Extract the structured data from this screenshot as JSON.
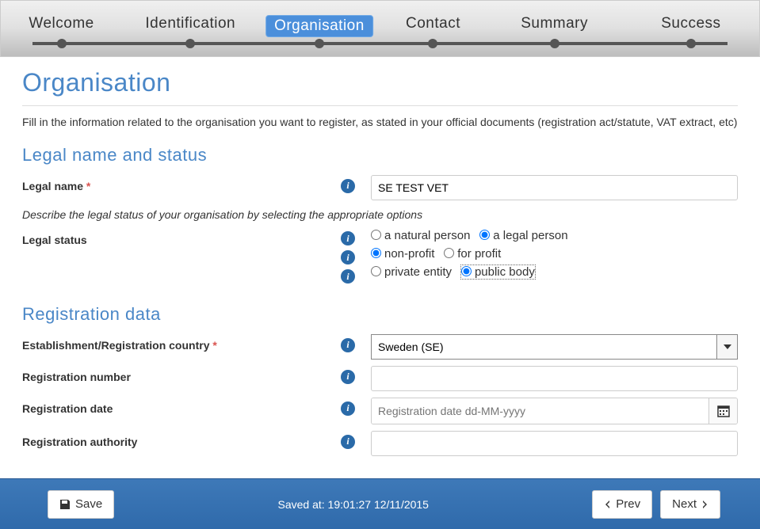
{
  "stepper": {
    "steps": [
      {
        "label": "Welcome",
        "pos": 8
      },
      {
        "label": "Identification",
        "pos": 25
      },
      {
        "label": "Organisation",
        "pos": 42,
        "active": true
      },
      {
        "label": "Contact",
        "pos": 57
      },
      {
        "label": "Summary",
        "pos": 73
      },
      {
        "label": "Success",
        "pos": 91
      }
    ]
  },
  "page": {
    "title": "Organisation",
    "intro": "Fill in the information related to the organisation you want to register, as stated in your official documents (registration act/statute, VAT extract, etc)"
  },
  "section1": {
    "title": "Legal name and status",
    "legal_name_label": "Legal name",
    "legal_name_value": "SE TEST VET",
    "describe": "Describe the legal status of your organisation by selecting the appropriate options",
    "legal_status_label": "Legal status",
    "radios": {
      "r1a": "a natural person",
      "r1b": "a legal person",
      "r2a": "non-profit",
      "r2b": "for profit",
      "r3a": "private entity",
      "r3b": "public body"
    }
  },
  "section2": {
    "title": "Registration data",
    "country_label": "Establishment/Registration country",
    "country_value": "Sweden (SE)",
    "number_label": "Registration number",
    "number_value": "",
    "date_label": "Registration date",
    "date_placeholder": "Registration date dd-MM-yyyy",
    "authority_label": "Registration authority",
    "authority_value": ""
  },
  "footer": {
    "save": "Save",
    "saved_at": "Saved at: 19:01:27 12/11/2015",
    "prev": "Prev",
    "next": "Next"
  }
}
